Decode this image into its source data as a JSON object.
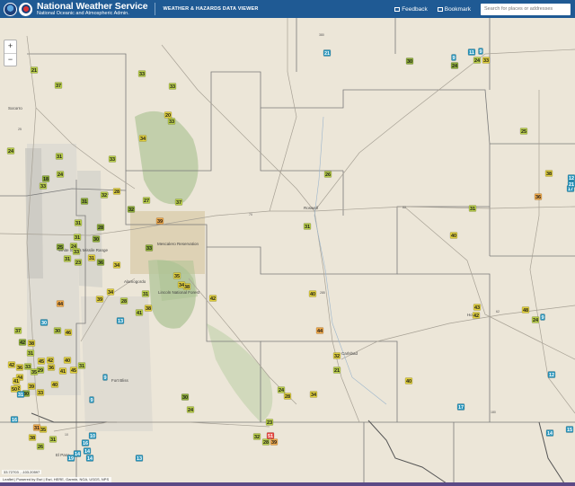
{
  "header": {
    "title": "National Weather Service",
    "subtitle": "National Oceanic and Atmospheric Admin.",
    "viewer_title": "WEATHER & HAZARDS DATA VIEWER",
    "feedback_label": "Feedback",
    "bookmark_label": "Bookmark",
    "search_placeholder": "Search for places or addresses"
  },
  "colors": {
    "header_bg": "#1f5a94",
    "marker_green": "#b9ce49",
    "marker_olive": "#8fae3a",
    "marker_yellow": "#e0cf3c",
    "marker_orange": "#f0a94a",
    "marker_red": "#e84640",
    "marker_teal": "#2c97bd"
  },
  "map": {
    "zoom_in_label": "+",
    "zoom_out_label": "−",
    "coordinates": "33.72703 , -103.20597",
    "attribution": "Leaflet | Powered by Esri | Esri, HERE, Garmin, NGA, USGS, NPS",
    "cities": [
      "Socorro",
      "Roswell",
      "Alamogordo",
      "Carlsbad",
      "Hobbs",
      "El Paso",
      "Mescalero Reservation",
      "Lincoln National Forest",
      "White Sands Missile Range",
      "Fort Bliss"
    ],
    "highways": [
      "380",
      "70",
      "285",
      "54",
      "180",
      "62",
      "82",
      "10",
      "25"
    ]
  },
  "stations": [
    {
      "id": 1,
      "value": "21",
      "level": "green"
    },
    {
      "id": 2,
      "value": "9",
      "level": "teal"
    },
    {
      "id": 3,
      "value": "24",
      "level": "green"
    },
    {
      "id": 4,
      "value": "33",
      "level": "yellow"
    },
    {
      "id": 5,
      "value": "24",
      "level": "olive"
    },
    {
      "id": 6,
      "value": "33",
      "level": "green"
    },
    {
      "id": 7,
      "value": "37",
      "level": "green"
    },
    {
      "id": 8,
      "value": "33",
      "level": "green"
    },
    {
      "id": 9,
      "value": "20",
      "level": "yellow"
    },
    {
      "id": 10,
      "value": "33",
      "level": "green"
    },
    {
      "id": 11,
      "value": "34",
      "level": "yellow"
    },
    {
      "id": 12,
      "value": "24",
      "level": "green"
    },
    {
      "id": 13,
      "value": "31",
      "level": "green"
    },
    {
      "id": 14,
      "value": "33",
      "level": "green"
    },
    {
      "id": 15,
      "value": "24",
      "level": "green"
    },
    {
      "id": 16,
      "value": "18",
      "level": "olive"
    },
    {
      "id": 17,
      "value": "33",
      "level": "green"
    },
    {
      "id": 18,
      "value": "28",
      "level": "yellow"
    },
    {
      "id": 19,
      "value": "32",
      "level": "green"
    },
    {
      "id": 20,
      "value": "31",
      "level": "olive"
    },
    {
      "id": 21,
      "value": "27",
      "level": "green"
    },
    {
      "id": 22,
      "value": "31",
      "level": "green"
    },
    {
      "id": 23,
      "value": "28",
      "level": "olive"
    },
    {
      "id": 24,
      "value": "30",
      "level": "olive"
    },
    {
      "id": 25,
      "value": "31",
      "level": "green"
    },
    {
      "id": 26,
      "value": "24",
      "level": "green"
    },
    {
      "id": 27,
      "value": "39",
      "level": "orange"
    },
    {
      "id": 28,
      "value": "37",
      "level": "green"
    },
    {
      "id": 29,
      "value": "32",
      "level": "olive"
    },
    {
      "id": 30,
      "value": "33",
      "level": "green"
    },
    {
      "id": 31,
      "value": "33",
      "level": "olive"
    },
    {
      "id": 32,
      "value": "36",
      "level": "olive"
    },
    {
      "id": 33,
      "value": "34",
      "level": "yellow"
    },
    {
      "id": 34,
      "value": "25",
      "level": "olive"
    },
    {
      "id": 35,
      "value": "31",
      "level": "yellow"
    },
    {
      "id": 36,
      "value": "31",
      "level": "green"
    },
    {
      "id": 37,
      "value": "23",
      "level": "green"
    },
    {
      "id": 38,
      "value": "38",
      "level": "yellow"
    },
    {
      "id": 39,
      "value": "34",
      "level": "yellow"
    },
    {
      "id": 40,
      "value": "35",
      "level": "yellow"
    },
    {
      "id": 41,
      "value": "42",
      "level": "yellow"
    },
    {
      "id": 42,
      "value": "34",
      "level": "yellow"
    },
    {
      "id": 43,
      "value": "31",
      "level": "green"
    },
    {
      "id": 44,
      "value": "38",
      "level": "yellow"
    },
    {
      "id": 45,
      "value": "28",
      "level": "green"
    },
    {
      "id": 46,
      "value": "41",
      "level": "green"
    },
    {
      "id": 47,
      "value": "39",
      "level": "yellow"
    },
    {
      "id": 48,
      "value": "44",
      "level": "orange"
    },
    {
      "id": 49,
      "value": "30",
      "level": "teal"
    },
    {
      "id": 50,
      "value": "13",
      "level": "teal"
    },
    {
      "id": 51,
      "value": "37",
      "level": "green"
    },
    {
      "id": 52,
      "value": "30",
      "level": "green"
    },
    {
      "id": 53,
      "value": "46",
      "level": "yellow"
    },
    {
      "id": 54,
      "value": "42",
      "level": "olive"
    },
    {
      "id": 55,
      "value": "38",
      "level": "yellow"
    },
    {
      "id": 56,
      "value": "31",
      "level": "green"
    },
    {
      "id": 57,
      "value": "42",
      "level": "yellow"
    },
    {
      "id": 58,
      "value": "31",
      "level": "green"
    },
    {
      "id": 59,
      "value": "45",
      "level": "yellow"
    },
    {
      "id": 60,
      "value": "40",
      "level": "yellow"
    },
    {
      "id": 61,
      "value": "36",
      "level": "yellow"
    },
    {
      "id": 62,
      "value": "33",
      "level": "green"
    },
    {
      "id": 63,
      "value": "29",
      "level": "green"
    },
    {
      "id": 64,
      "value": "35",
      "level": "green"
    },
    {
      "id": 65,
      "value": "41",
      "level": "yellow"
    },
    {
      "id": 66,
      "value": "45",
      "level": "yellow"
    },
    {
      "id": 67,
      "value": "36",
      "level": "yellow"
    },
    {
      "id": 68,
      "value": "42",
      "level": "yellow"
    },
    {
      "id": 69,
      "value": "44",
      "level": "yellow"
    },
    {
      "id": 70,
      "value": "40",
      "level": "yellow"
    },
    {
      "id": 71,
      "value": "42",
      "level": "yellow"
    },
    {
      "id": 72,
      "value": "41",
      "level": "yellow"
    },
    {
      "id": 73,
      "value": "30",
      "level": "olive"
    },
    {
      "id": 74,
      "value": "33",
      "level": "yellow"
    },
    {
      "id": 75,
      "value": "39",
      "level": "yellow"
    },
    {
      "id": 76,
      "value": "31",
      "level": "teal"
    },
    {
      "id": 77,
      "value": "50",
      "level": "yellow"
    },
    {
      "id": 78,
      "value": "9",
      "level": "teal"
    },
    {
      "id": 79,
      "value": "9",
      "level": "teal"
    },
    {
      "id": 80,
      "value": "30",
      "level": "olive"
    },
    {
      "id": 81,
      "value": "24",
      "level": "green"
    },
    {
      "id": 82,
      "value": "23",
      "level": "green"
    },
    {
      "id": 83,
      "value": "24",
      "level": "green"
    },
    {
      "id": 84,
      "value": "28",
      "level": "yellow"
    },
    {
      "id": 85,
      "value": "32",
      "level": "green"
    },
    {
      "id": 86,
      "value": "28",
      "level": "green"
    },
    {
      "id": 87,
      "value": "16",
      "level": "teal"
    },
    {
      "id": 88,
      "value": "34",
      "level": "yellow"
    },
    {
      "id": 89,
      "value": "32",
      "level": "yellow"
    },
    {
      "id": 90,
      "value": "21",
      "level": "green"
    },
    {
      "id": 91,
      "value": "44",
      "level": "orange"
    },
    {
      "id": 92,
      "value": "40",
      "level": "yellow"
    },
    {
      "id": 93,
      "value": "31",
      "level": "green"
    },
    {
      "id": 94,
      "value": "26",
      "level": "green"
    },
    {
      "id": 95,
      "value": "21",
      "level": "teal"
    },
    {
      "id": 96,
      "value": "30",
      "level": "olive"
    },
    {
      "id": 97,
      "value": "11",
      "level": "teal"
    },
    {
      "id": 98,
      "value": "9",
      "level": "teal"
    },
    {
      "id": 99,
      "value": "40",
      "level": "yellow"
    },
    {
      "id": 100,
      "value": "36",
      "level": "orange"
    },
    {
      "id": 101,
      "value": "38",
      "level": "yellow"
    },
    {
      "id": 102,
      "value": "31",
      "level": "green"
    },
    {
      "id": 103,
      "value": "43",
      "level": "yellow"
    },
    {
      "id": 104,
      "value": "42",
      "level": "yellow"
    },
    {
      "id": 105,
      "value": "48",
      "level": "yellow"
    },
    {
      "id": 106,
      "value": "24",
      "level": "green"
    },
    {
      "id": 107,
      "value": "9",
      "level": "teal"
    },
    {
      "id": 108,
      "value": "25",
      "level": "green"
    },
    {
      "id": 109,
      "value": "17",
      "level": "teal"
    },
    {
      "id": 110,
      "value": "21",
      "level": "teal"
    },
    {
      "id": 111,
      "value": "12",
      "level": "teal"
    },
    {
      "id": 112,
      "value": "51",
      "level": "red"
    },
    {
      "id": 113,
      "value": "40",
      "level": "yellow"
    },
    {
      "id": 114,
      "value": "17",
      "level": "teal"
    },
    {
      "id": 115,
      "value": "12",
      "level": "teal"
    },
    {
      "id": 116,
      "value": "14",
      "level": "teal"
    },
    {
      "id": 117,
      "value": "15",
      "level": "teal"
    },
    {
      "id": 118,
      "value": "10",
      "level": "teal"
    },
    {
      "id": 119,
      "value": "16",
      "level": "teal"
    },
    {
      "id": 120,
      "value": "14",
      "level": "teal"
    },
    {
      "id": 121,
      "value": "14",
      "level": "teal"
    },
    {
      "id": 122,
      "value": "19",
      "level": "teal"
    },
    {
      "id": 123,
      "value": "14",
      "level": "teal"
    },
    {
      "id": 124,
      "value": "13",
      "level": "teal"
    },
    {
      "id": 125,
      "value": "31",
      "level": "green"
    },
    {
      "id": 126,
      "value": "38",
      "level": "yellow"
    },
    {
      "id": 127,
      "value": "26",
      "level": "green"
    },
    {
      "id": 128,
      "value": "35",
      "level": "yellow"
    },
    {
      "id": 129,
      "value": "39",
      "level": "orange"
    },
    {
      "id": 130,
      "value": "31",
      "level": "orange"
    }
  ]
}
